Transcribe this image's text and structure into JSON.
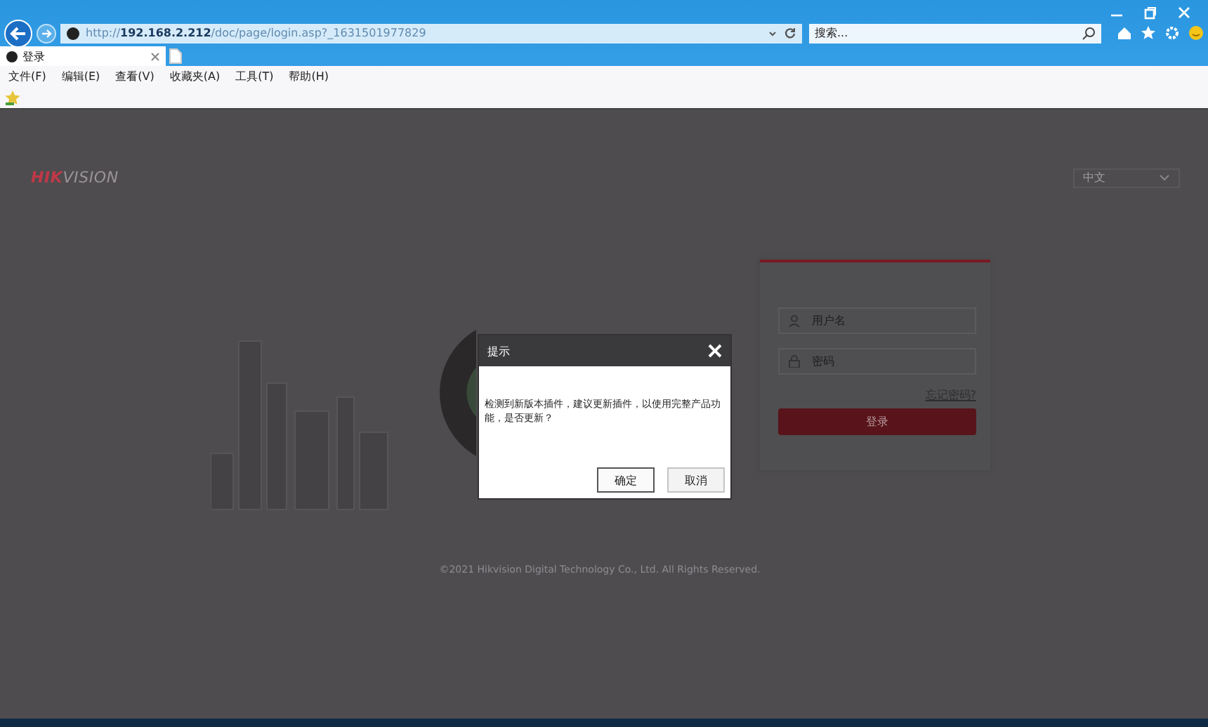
{
  "browser": {
    "address": {
      "prefix": "http://",
      "host": "192.168.2.212",
      "path": "/doc/page/login.asp?_1631501977829"
    },
    "search": {
      "placeholder": "搜索..."
    },
    "tabs": [
      {
        "label": "登录",
        "selected": true
      }
    ],
    "menu": [
      "文件(F)",
      "编辑(E)",
      "查看(V)",
      "收藏夹(A)",
      "工具(T)",
      "帮助(H)"
    ]
  },
  "page": {
    "logo": {
      "bold": "HIK",
      "rest": "VISION"
    },
    "language": "中文",
    "login": {
      "username_placeholder": "用户名",
      "password_placeholder": "密码",
      "forgot": "忘记密码?",
      "submit": "登录"
    },
    "copyright": "©2021 Hikvision Digital Technology Co., Ltd. All Rights Reserved."
  },
  "dialog": {
    "title": "提示",
    "message": "检测到新版本插件，建议更新插件，以使用完整产品功能，是否更新？",
    "buttons": [
      {
        "label": "确定",
        "selected": true
      },
      {
        "label": "取消",
        "selected": false
      }
    ]
  }
}
